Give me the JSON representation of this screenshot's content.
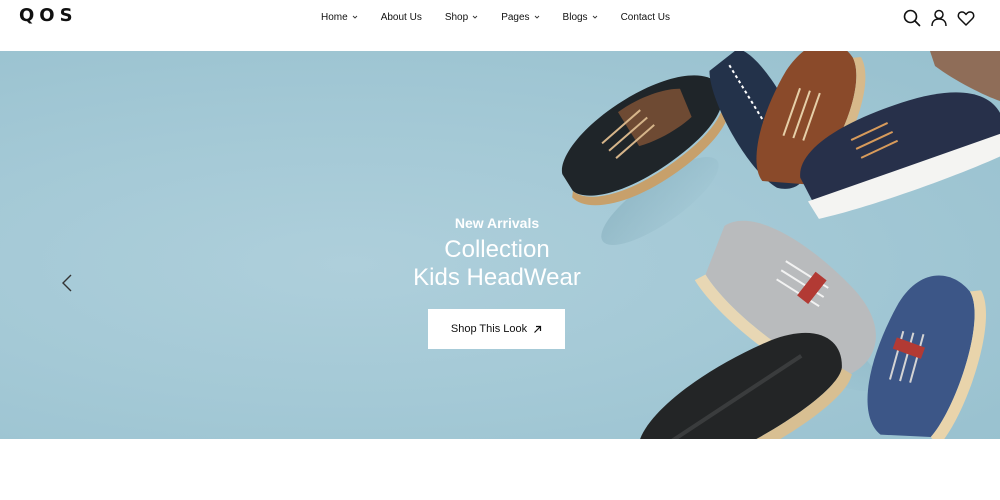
{
  "brand": {
    "logo_text": "QOS"
  },
  "nav": {
    "items": [
      {
        "label": "Home",
        "has_dropdown": true
      },
      {
        "label": "About Us",
        "has_dropdown": false
      },
      {
        "label": "Shop",
        "has_dropdown": true
      },
      {
        "label": "Pages",
        "has_dropdown": true
      },
      {
        "label": "Blogs",
        "has_dropdown": true
      },
      {
        "label": "Contact Us",
        "has_dropdown": false
      }
    ]
  },
  "header_icons": [
    "search-icon",
    "user-icon",
    "heart-icon"
  ],
  "hero": {
    "subtitle": "New Arrivals",
    "title_line1": "Collection",
    "title_line2": "Kids HeadWear",
    "cta_label": "Shop This Look",
    "cta_icon": "arrow-up-right-icon",
    "prev_icon": "chevron-left-icon",
    "background_color": "#a7cad7"
  },
  "colors": {
    "text": "#111111",
    "white": "#ffffff"
  }
}
